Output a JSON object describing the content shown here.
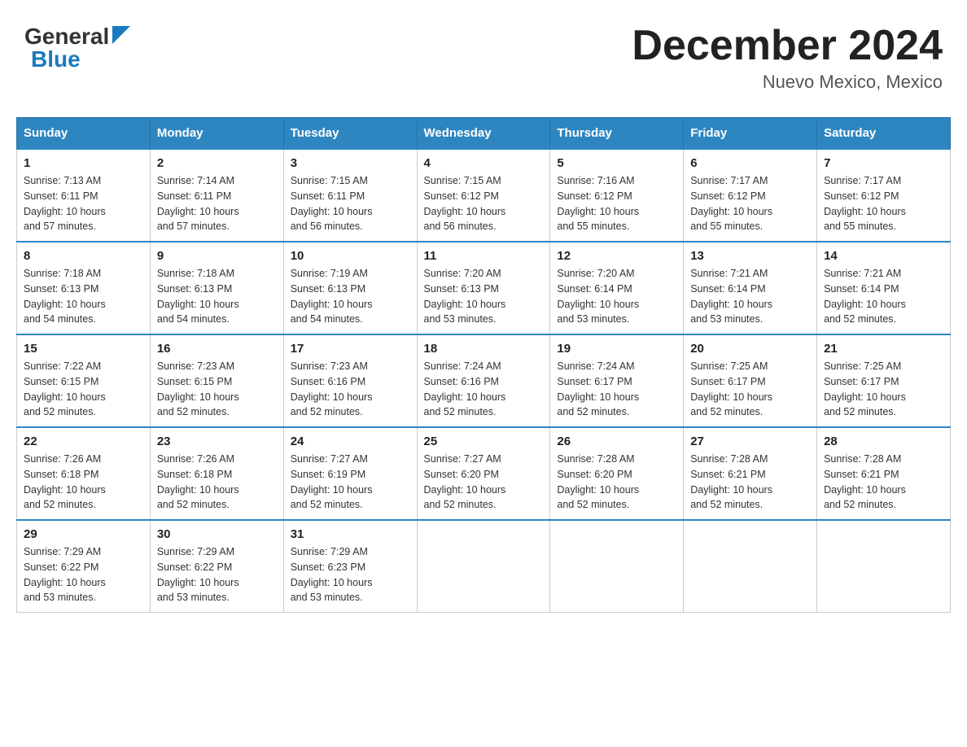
{
  "header": {
    "logo_general": "General",
    "logo_blue": "Blue",
    "month_title": "December 2024",
    "location": "Nuevo Mexico, Mexico"
  },
  "weekdays": [
    "Sunday",
    "Monday",
    "Tuesday",
    "Wednesday",
    "Thursday",
    "Friday",
    "Saturday"
  ],
  "weeks": [
    [
      {
        "num": "1",
        "sunrise": "7:13 AM",
        "sunset": "6:11 PM",
        "daylight": "10 hours and 57 minutes."
      },
      {
        "num": "2",
        "sunrise": "7:14 AM",
        "sunset": "6:11 PM",
        "daylight": "10 hours and 57 minutes."
      },
      {
        "num": "3",
        "sunrise": "7:15 AM",
        "sunset": "6:11 PM",
        "daylight": "10 hours and 56 minutes."
      },
      {
        "num": "4",
        "sunrise": "7:15 AM",
        "sunset": "6:12 PM",
        "daylight": "10 hours and 56 minutes."
      },
      {
        "num": "5",
        "sunrise": "7:16 AM",
        "sunset": "6:12 PM",
        "daylight": "10 hours and 55 minutes."
      },
      {
        "num": "6",
        "sunrise": "7:17 AM",
        "sunset": "6:12 PM",
        "daylight": "10 hours and 55 minutes."
      },
      {
        "num": "7",
        "sunrise": "7:17 AM",
        "sunset": "6:12 PM",
        "daylight": "10 hours and 55 minutes."
      }
    ],
    [
      {
        "num": "8",
        "sunrise": "7:18 AM",
        "sunset": "6:13 PM",
        "daylight": "10 hours and 54 minutes."
      },
      {
        "num": "9",
        "sunrise": "7:18 AM",
        "sunset": "6:13 PM",
        "daylight": "10 hours and 54 minutes."
      },
      {
        "num": "10",
        "sunrise": "7:19 AM",
        "sunset": "6:13 PM",
        "daylight": "10 hours and 54 minutes."
      },
      {
        "num": "11",
        "sunrise": "7:20 AM",
        "sunset": "6:13 PM",
        "daylight": "10 hours and 53 minutes."
      },
      {
        "num": "12",
        "sunrise": "7:20 AM",
        "sunset": "6:14 PM",
        "daylight": "10 hours and 53 minutes."
      },
      {
        "num": "13",
        "sunrise": "7:21 AM",
        "sunset": "6:14 PM",
        "daylight": "10 hours and 53 minutes."
      },
      {
        "num": "14",
        "sunrise": "7:21 AM",
        "sunset": "6:14 PM",
        "daylight": "10 hours and 52 minutes."
      }
    ],
    [
      {
        "num": "15",
        "sunrise": "7:22 AM",
        "sunset": "6:15 PM",
        "daylight": "10 hours and 52 minutes."
      },
      {
        "num": "16",
        "sunrise": "7:23 AM",
        "sunset": "6:15 PM",
        "daylight": "10 hours and 52 minutes."
      },
      {
        "num": "17",
        "sunrise": "7:23 AM",
        "sunset": "6:16 PM",
        "daylight": "10 hours and 52 minutes."
      },
      {
        "num": "18",
        "sunrise": "7:24 AM",
        "sunset": "6:16 PM",
        "daylight": "10 hours and 52 minutes."
      },
      {
        "num": "19",
        "sunrise": "7:24 AM",
        "sunset": "6:17 PM",
        "daylight": "10 hours and 52 minutes."
      },
      {
        "num": "20",
        "sunrise": "7:25 AM",
        "sunset": "6:17 PM",
        "daylight": "10 hours and 52 minutes."
      },
      {
        "num": "21",
        "sunrise": "7:25 AM",
        "sunset": "6:17 PM",
        "daylight": "10 hours and 52 minutes."
      }
    ],
    [
      {
        "num": "22",
        "sunrise": "7:26 AM",
        "sunset": "6:18 PM",
        "daylight": "10 hours and 52 minutes."
      },
      {
        "num": "23",
        "sunrise": "7:26 AM",
        "sunset": "6:18 PM",
        "daylight": "10 hours and 52 minutes."
      },
      {
        "num": "24",
        "sunrise": "7:27 AM",
        "sunset": "6:19 PM",
        "daylight": "10 hours and 52 minutes."
      },
      {
        "num": "25",
        "sunrise": "7:27 AM",
        "sunset": "6:20 PM",
        "daylight": "10 hours and 52 minutes."
      },
      {
        "num": "26",
        "sunrise": "7:28 AM",
        "sunset": "6:20 PM",
        "daylight": "10 hours and 52 minutes."
      },
      {
        "num": "27",
        "sunrise": "7:28 AM",
        "sunset": "6:21 PM",
        "daylight": "10 hours and 52 minutes."
      },
      {
        "num": "28",
        "sunrise": "7:28 AM",
        "sunset": "6:21 PM",
        "daylight": "10 hours and 52 minutes."
      }
    ],
    [
      {
        "num": "29",
        "sunrise": "7:29 AM",
        "sunset": "6:22 PM",
        "daylight": "10 hours and 53 minutes."
      },
      {
        "num": "30",
        "sunrise": "7:29 AM",
        "sunset": "6:22 PM",
        "daylight": "10 hours and 53 minutes."
      },
      {
        "num": "31",
        "sunrise": "7:29 AM",
        "sunset": "6:23 PM",
        "daylight": "10 hours and 53 minutes."
      },
      null,
      null,
      null,
      null
    ]
  ],
  "labels": {
    "sunrise": "Sunrise:",
    "sunset": "Sunset:",
    "daylight": "Daylight:"
  }
}
